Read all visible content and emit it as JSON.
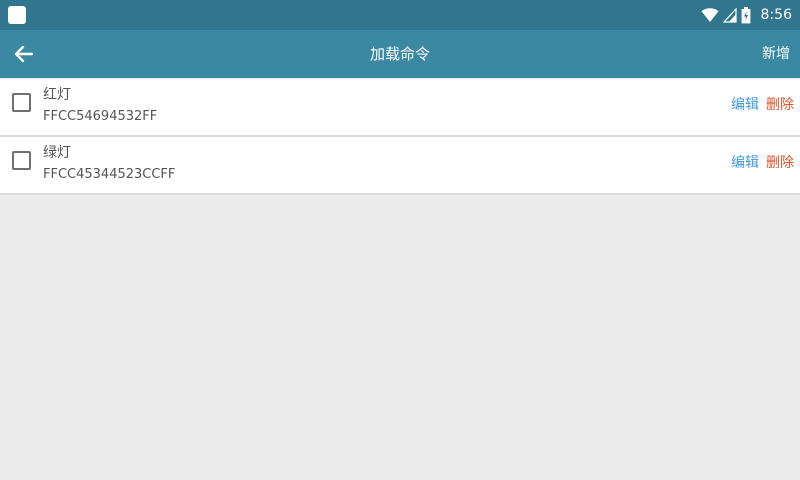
{
  "status_bar": {
    "time": "8:56",
    "icons": [
      "app-icon",
      "wifi-icon",
      "signal-icon",
      "battery-icon"
    ]
  },
  "app_bar": {
    "back_icon": "arrow-left-icon",
    "title": "加载命令",
    "add_label": "新增"
  },
  "colors": {
    "status_bar": "#31758e",
    "app_bar": "#3a88a2",
    "edit": "#3e9ad9",
    "delete": "#e0522a",
    "background": "#ebebeb"
  },
  "commands": [
    {
      "name": "红灯",
      "code": "FFCC54694532FF",
      "edit_label": "编辑",
      "delete_label": "删除",
      "checked": false
    },
    {
      "name": "绿灯",
      "code": "FFCC45344523CCFF",
      "edit_label": "编辑",
      "delete_label": "删除",
      "checked": false
    }
  ]
}
